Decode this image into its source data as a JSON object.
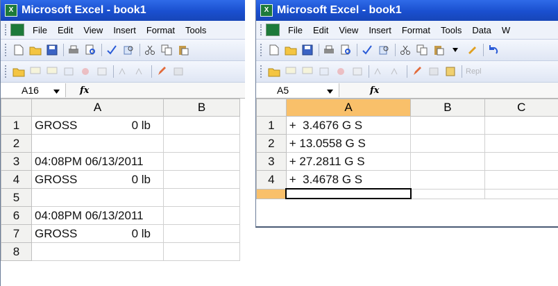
{
  "left": {
    "title": "Microsoft Excel - book1",
    "menu": [
      "File",
      "Edit",
      "View",
      "Insert",
      "Format",
      "Tools"
    ],
    "name_box": "A16",
    "columns": [
      "A",
      "B"
    ],
    "rows": [
      {
        "num": "1",
        "a_label": "GROSS",
        "a_value": "0 lb",
        "a_text": ""
      },
      {
        "num": "2",
        "a_label": "",
        "a_value": "",
        "a_text": ""
      },
      {
        "num": "3",
        "a_label": "",
        "a_value": "",
        "a_text": "04:08PM 06/13/2011"
      },
      {
        "num": "4",
        "a_label": "GROSS",
        "a_value": "0 lb",
        "a_text": ""
      },
      {
        "num": "5",
        "a_label": "",
        "a_value": "",
        "a_text": ""
      },
      {
        "num": "6",
        "a_label": "",
        "a_value": "",
        "a_text": "04:08PM 06/13/2011"
      },
      {
        "num": "7",
        "a_label": "GROSS",
        "a_value": "0 lb",
        "a_text": ""
      },
      {
        "num": "8",
        "a_label": "",
        "a_value": "",
        "a_text": ""
      }
    ]
  },
  "right": {
    "title": "Microsoft Excel - book1",
    "menu": [
      "File",
      "Edit",
      "View",
      "Insert",
      "Format",
      "Tools",
      "Data",
      "W"
    ],
    "toolbar_extra": "Repl",
    "name_box": "A5",
    "columns": [
      "A",
      "B",
      "C"
    ],
    "rows": [
      {
        "num": "1",
        "a": "+  3.4676 G S"
      },
      {
        "num": "2",
        "a": "+ 13.0558 G S"
      },
      {
        "num": "3",
        "a": "+ 27.2811 G S"
      },
      {
        "num": "4",
        "a": "+  3.4678 G S"
      }
    ]
  },
  "fx_symbol": "fx",
  "colors": {
    "titlebar": "#1a4fcf",
    "selected_header": "#f9c06a",
    "excel_green": "#1d7a3a"
  }
}
